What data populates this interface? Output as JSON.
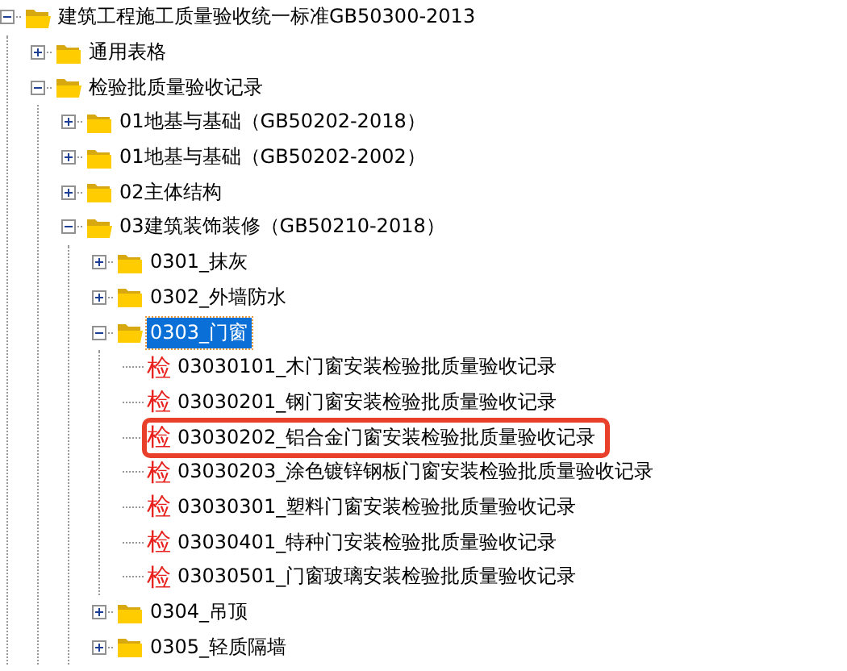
{
  "tree": [
    {
      "kind": "folder",
      "label": "建筑工程施工质量验收统一标准GB50300-2013",
      "expanded": true,
      "selected": false,
      "children": [
        {
          "kind": "folder",
          "label": "通用表格",
          "expanded": false,
          "selected": false
        },
        {
          "kind": "folder",
          "label": "检验批质量验收记录",
          "expanded": true,
          "selected": false,
          "children": [
            {
              "kind": "folder",
              "label": "01地基与基础（GB50202-2018）",
              "expanded": false,
              "selected": false
            },
            {
              "kind": "folder",
              "label": "01地基与基础（GB50202-2002）",
              "expanded": false,
              "selected": false
            },
            {
              "kind": "folder",
              "label": "02主体结构",
              "expanded": false,
              "selected": false
            },
            {
              "kind": "folder",
              "label": "03建筑装饰装修（GB50210-2018）",
              "expanded": true,
              "selected": false,
              "children": [
                {
                  "kind": "folder",
                  "label": "0301_抹灰",
                  "expanded": false,
                  "selected": false
                },
                {
                  "kind": "folder",
                  "label": "0302_外墙防水",
                  "expanded": false,
                  "selected": false
                },
                {
                  "kind": "folder",
                  "label": "0303_门窗",
                  "expanded": true,
                  "selected": true,
                  "children": [
                    {
                      "kind": "form",
                      "badge": "检",
                      "label": "03030101_木门窗安装检验批质量验收记录",
                      "selected": false,
                      "highlighted": false
                    },
                    {
                      "kind": "form",
                      "badge": "检",
                      "label": "03030201_钢门窗安装检验批质量验收记录",
                      "selected": false,
                      "highlighted": false
                    },
                    {
                      "kind": "form",
                      "badge": "检",
                      "label": "03030202_铝合金门窗安装检验批质量验收记录",
                      "selected": false,
                      "highlighted": true
                    },
                    {
                      "kind": "form",
                      "badge": "检",
                      "label": "03030203_涂色镀锌钢板门窗安装检验批质量验收记录",
                      "selected": false,
                      "highlighted": false
                    },
                    {
                      "kind": "form",
                      "badge": "检",
                      "label": "03030301_塑料门窗安装检验批质量验收记录",
                      "selected": false,
                      "highlighted": false
                    },
                    {
                      "kind": "form",
                      "badge": "检",
                      "label": "03030401_特种门安装检验批质量验收记录",
                      "selected": false,
                      "highlighted": false
                    },
                    {
                      "kind": "form",
                      "badge": "检",
                      "label": "03030501_门窗玻璃安装检验批质量验收记录",
                      "selected": false,
                      "highlighted": false
                    }
                  ]
                },
                {
                  "kind": "folder",
                  "label": "0304_吊顶",
                  "expanded": false,
                  "selected": false
                },
                {
                  "kind": "folder",
                  "label": "0305_轻质隔墙",
                  "expanded": false,
                  "selected": false
                }
              ]
            }
          ]
        }
      ]
    }
  ]
}
